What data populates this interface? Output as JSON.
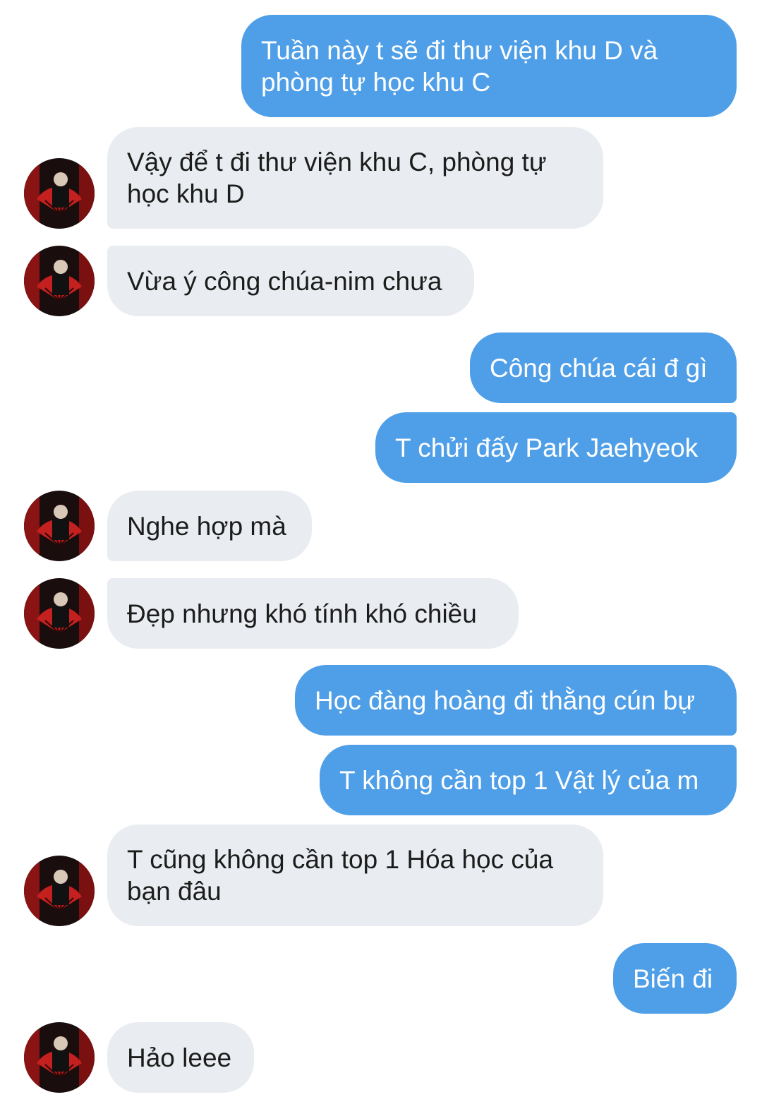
{
  "messages": [
    {
      "text": "Tuần này t sẽ đi thư viện khu D và\nphòng tự học khu C"
    },
    {
      "text": "Vậy để t đi thư viện khu C, phòng tự\nhọc khu D"
    },
    {
      "text": "Vừa ý công chúa-nim chưa"
    },
    {
      "text": "Công chúa cái đ gì"
    },
    {
      "text": "T chửi đấy Park Jaehyeok"
    },
    {
      "text": "Nghe hợp mà"
    },
    {
      "text": "Đẹp nhưng khó tính khó chiều"
    },
    {
      "text": "Học đàng hoàng đi thằng cún bự"
    },
    {
      "text": "T không cần top 1 Vật lý của m"
    },
    {
      "text": "T cũng không cần top 1 Hóa học của\nbạn đâu"
    },
    {
      "text": "Biến đi"
    },
    {
      "text": "Hảo leee"
    }
  ],
  "colors": {
    "outgoing_bubble": "#4f9fe8",
    "incoming_bubble": "#e9ecf0",
    "outgoing_text": "#ffffff",
    "incoming_text": "#1c1c1c"
  },
  "avatar_icon": "contact-avatar"
}
